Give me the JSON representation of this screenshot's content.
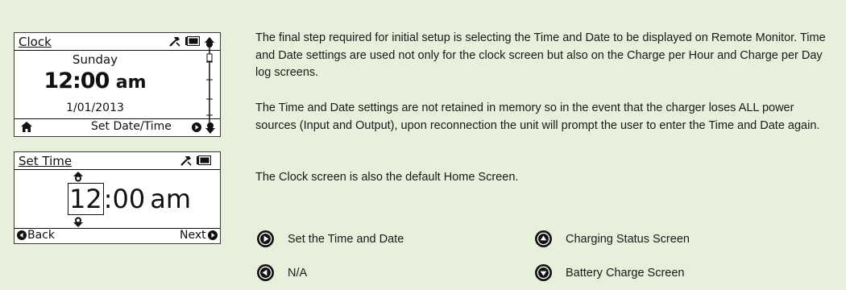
{
  "clock_screen": {
    "title": "Clock",
    "day": "Sunday",
    "time": "12:00",
    "ampm": "am",
    "date": "1/01/2013",
    "footer_action": "Set Date/Time"
  },
  "set_time_screen": {
    "title": "Set Time",
    "hour": "12",
    "separator": ":",
    "minutes": "00",
    "ampm": "am",
    "back_label": "Back",
    "next_label": "Next"
  },
  "paragraphs": {
    "p1": "The final step required for initial setup is selecting the Time and Date to be displayed on Remote Monitor. Time and Date settings are used not only for the clock screen but also on the Charge per Hour and Charge per Day log screens.",
    "p2": "The Time and Date settings are not retained in memory so in the event that the charger loses ALL power sources (Input and Output), upon reconnection the unit will prompt the user to enter the Time and Date again.",
    "p3": "The Clock screen is also the default Home Screen."
  },
  "button_legend": {
    "right": "Set the Time and Date",
    "left": "N/A",
    "up": "Charging Status Screen",
    "down": "Battery Charge Screen"
  },
  "icons": [
    "wrench-icon",
    "battery-icon",
    "home-icon",
    "right-arrow-icon",
    "left-arrow-icon",
    "up-arrow-icon",
    "down-arrow-icon"
  ],
  "colors": {
    "background": "#e6f0da",
    "screen": "#ffffff",
    "button": "#111111"
  }
}
